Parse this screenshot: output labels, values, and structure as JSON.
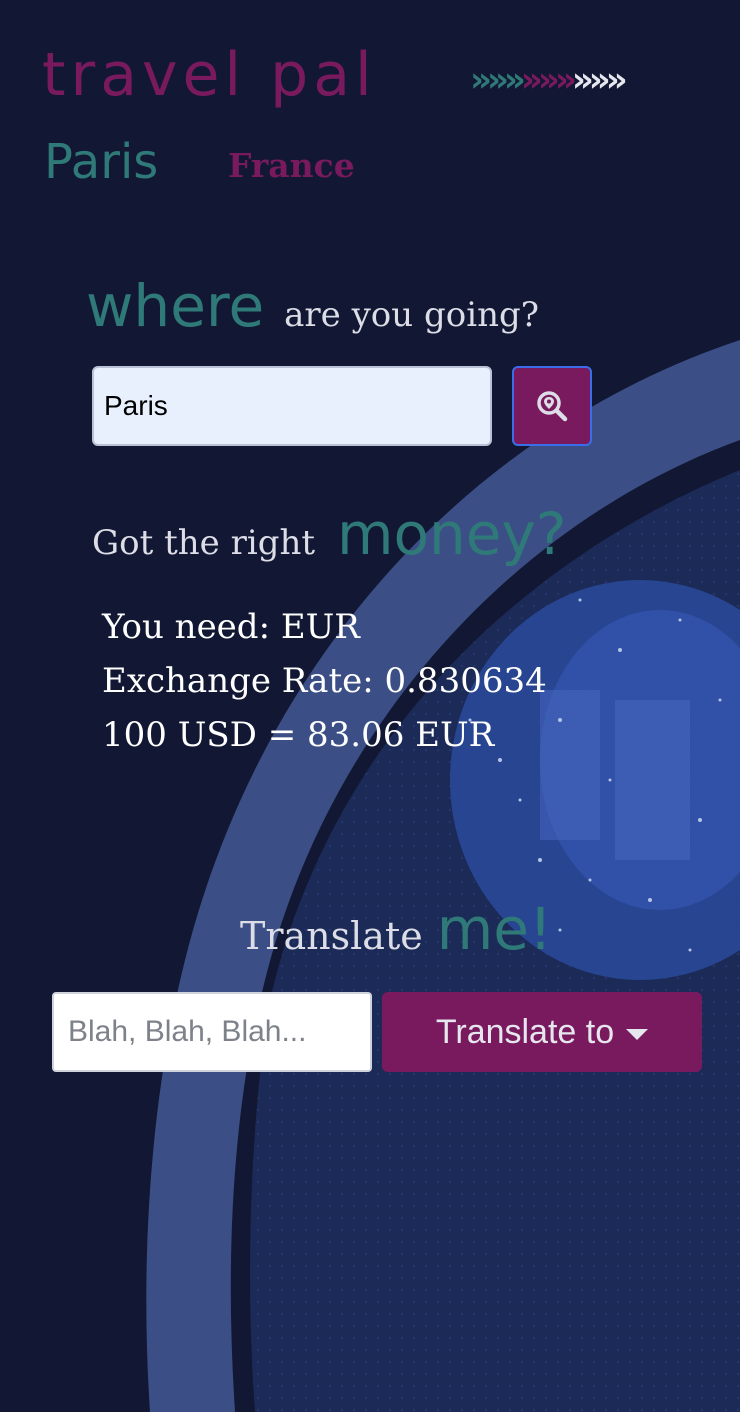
{
  "header": {
    "brand": "travel pal",
    "chevrons_teal": "»»»",
    "chevrons_purple": "»»»",
    "chevrons_white": "»»»",
    "city": "Paris",
    "country": "France"
  },
  "destination": {
    "heading_big": "where",
    "heading_small": "are you going?",
    "input_value": "Paris",
    "search_icon": "map-search-icon"
  },
  "money": {
    "heading_small": "Got the right",
    "heading_big": "money?",
    "you_need": "You need: EUR",
    "exchange_rate": "Exchange Rate: 0.830634",
    "conversion": "100 USD = 83.06 EUR"
  },
  "translate": {
    "heading_small": "Translate",
    "heading_big": "me!",
    "input_placeholder": "Blah, Blah, Blah...",
    "button_label": "Translate to",
    "button_icon": "caret-down-icon"
  },
  "colors": {
    "background": "#121833",
    "accent_purple": "#7a1a5e",
    "accent_teal": "#2f7a78",
    "swoosh": "#3b4f86"
  }
}
